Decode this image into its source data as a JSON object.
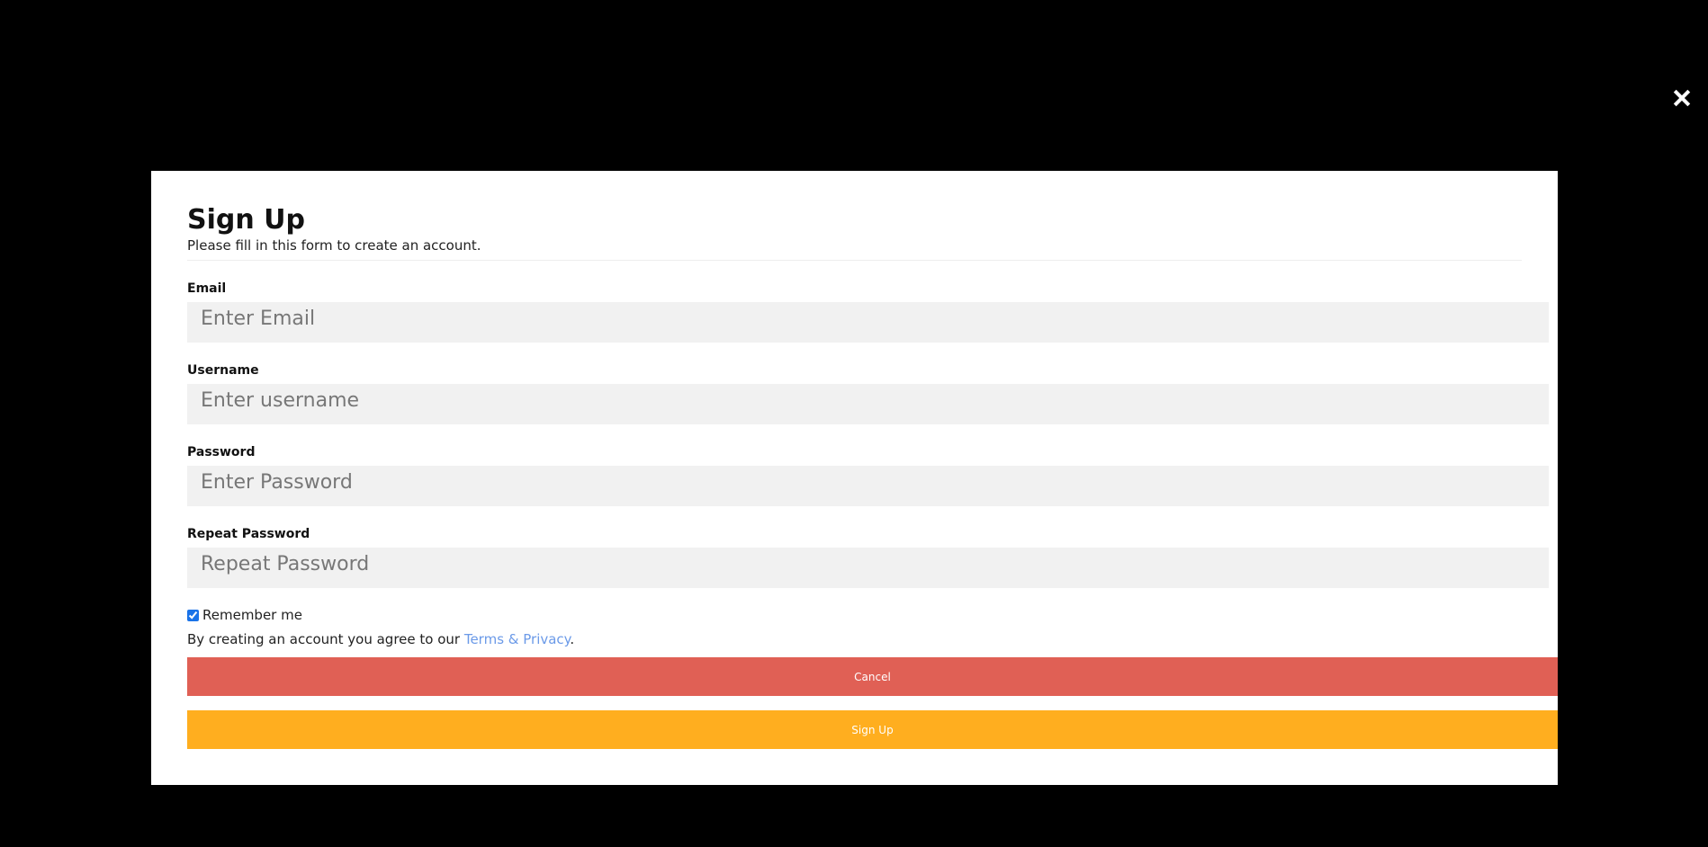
{
  "modal": {
    "title": "Sign Up",
    "subtitle": "Please fill in this form to create an account."
  },
  "fields": {
    "email": {
      "label": "Email",
      "placeholder": "Enter Email",
      "value": ""
    },
    "username": {
      "label": "Username",
      "placeholder": "Enter username",
      "value": ""
    },
    "password": {
      "label": "Password",
      "placeholder": "Enter Password",
      "value": ""
    },
    "repeat_password": {
      "label": "Repeat Password",
      "placeholder": "Repeat Password",
      "value": ""
    }
  },
  "remember": {
    "label": "Remember me",
    "checked": true
  },
  "terms": {
    "prefix": "By creating an account you agree to our ",
    "link_text": "Terms & Privacy",
    "suffix": "."
  },
  "buttons": {
    "cancel_label": "Cancel",
    "signup_label": "Sign Up"
  },
  "icons": {
    "close": "close-icon"
  },
  "colors": {
    "cancel": "#e06055",
    "signup": "#ffae1f",
    "link": "#6b9ae8",
    "input_bg": "#f1f1f1"
  }
}
